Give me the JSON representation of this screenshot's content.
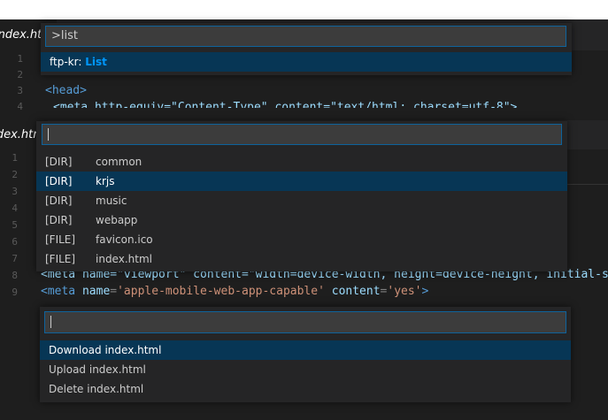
{
  "tabs": {
    "tab1": "index.html",
    "tab2": "index.html"
  },
  "editor": {
    "lines_a": [
      "1",
      "2",
      "3",
      "4"
    ],
    "lines_b": [
      "1",
      "2",
      "3",
      "4",
      "5",
      "6",
      "7",
      "8",
      "9"
    ],
    "code_head": "<head>",
    "code_meta1_partial": "<meta http-equiv=\"Content-Type\" content=\"text/html; charset=utf-8\">",
    "code_meta_viewport": "<meta name=\"viewport\" content=\"width=device-width, height=device-height, initial-s",
    "code_meta_apple_tag": "<meta",
    "code_meta_apple_attr1": "name",
    "code_meta_apple_val1": "'apple-mobile-web-app-capable'",
    "code_meta_apple_attr2": "content",
    "code_meta_apple_val2": "'yes'"
  },
  "palette_command": {
    "input_value": ">list",
    "items": [
      {
        "prefix": "ftp-kr: ",
        "highlight": "List"
      }
    ]
  },
  "palette_files": {
    "input_value": "",
    "items": [
      {
        "kind": "[DIR]",
        "name": "common"
      },
      {
        "kind": "[DIR]",
        "name": "krjs"
      },
      {
        "kind": "[DIR]",
        "name": "music"
      },
      {
        "kind": "[DIR]",
        "name": "webapp"
      },
      {
        "kind": "[FILE]",
        "name": "favicon.ico"
      },
      {
        "kind": "[FILE]",
        "name": "index.html"
      }
    ],
    "selected_index": 1
  },
  "palette_actions": {
    "input_value": "",
    "items": [
      "Download index.html",
      "Upload index.html",
      "Delete index.html"
    ],
    "selected_index": 0
  },
  "colors": {
    "selection": "#073655",
    "highlight": "#0097fb",
    "input_border": "#0e639c"
  }
}
